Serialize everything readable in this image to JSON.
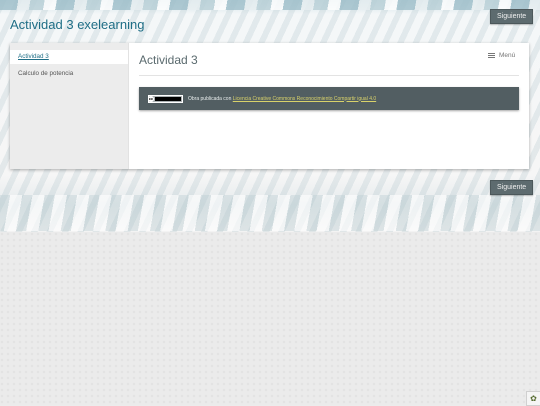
{
  "site": {
    "title": "Actividad 3 exelearning"
  },
  "buttons": {
    "next_top": "Siguiente",
    "next_bottom": "Siguiente"
  },
  "nav": {
    "items": [
      {
        "label": "Actividad 3",
        "active": true
      },
      {
        "label": "Calculo de potencia",
        "active": false
      }
    ]
  },
  "page": {
    "title": "Actividad 3"
  },
  "menu": {
    "label": "Menú",
    "icon": "hamburger-icon"
  },
  "license": {
    "badge_text": "cc",
    "prefix": "Obra publicada con",
    "link_text": "Licencia Creative Commons Reconocimiento Compartir igual 4.0"
  },
  "corner": {
    "icon": "exelearning-logo-icon"
  },
  "colors": {
    "accent": "#1f6e86",
    "button": "#5d6b6f",
    "license_bg": "#525e62",
    "link": "#d9d26a"
  }
}
